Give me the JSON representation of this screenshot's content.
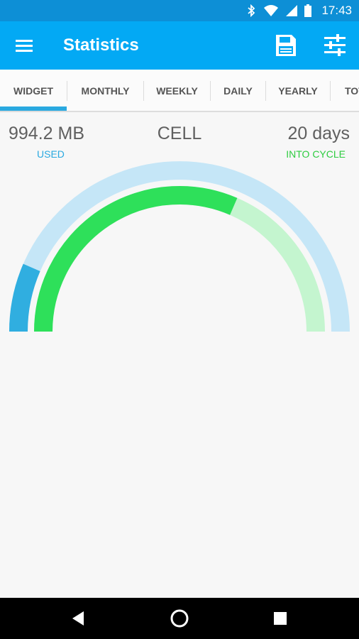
{
  "status_bar": {
    "time": "17:43",
    "icons": [
      "bluetooth-icon",
      "wifi-icon",
      "signal-icon",
      "battery-icon"
    ]
  },
  "app_bar": {
    "title": "Statistics",
    "background": "#03a9f4",
    "icons": [
      "menu-icon",
      "save-icon",
      "settings-sliders-icon"
    ]
  },
  "tabs": [
    {
      "label": "WIDGET",
      "selected": true
    },
    {
      "label": "MONTHLY",
      "selected": false
    },
    {
      "label": "WEEKLY",
      "selected": false
    },
    {
      "label": "DAILY",
      "selected": false
    },
    {
      "label": "YEARLY",
      "selected": false
    },
    {
      "label": "TOT",
      "selected": false
    }
  ],
  "summary": {
    "used_value": "994.2 MB",
    "used_label": "USED",
    "network": "CELL",
    "cycle_value": "20 days",
    "cycle_label": "INTO CYCLE"
  },
  "gauge": {
    "usage_fraction": 0.13,
    "cycle_fraction": 0.63,
    "colors": {
      "usage_track": "#c5e6f7",
      "usage_fill": "#30aee0",
      "cycle_track": "#c4f5cf",
      "cycle_fill": "#2ee05a"
    }
  },
  "nav_bar": {
    "icons": [
      "back-icon",
      "home-icon",
      "recents-icon"
    ]
  }
}
